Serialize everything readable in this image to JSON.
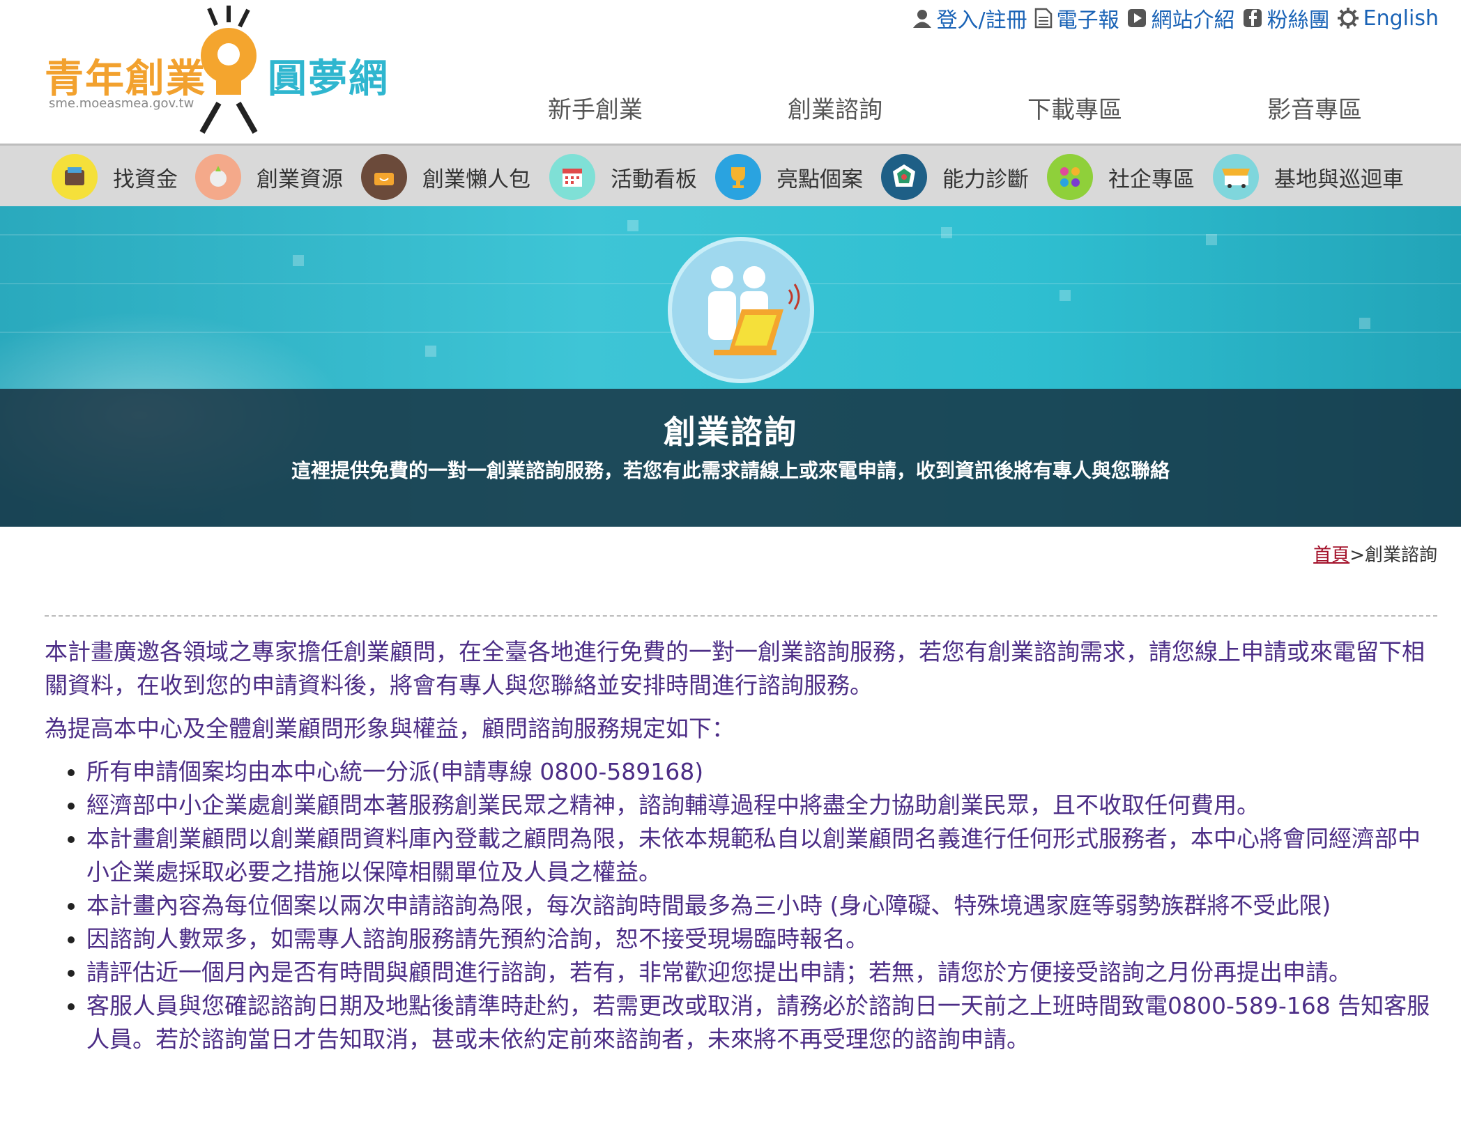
{
  "logo": {
    "text_left": "青年創業",
    "text_right": "圓夢網",
    "url": "sme.moeasmea.gov.tw"
  },
  "toplinks": [
    {
      "label": "登入/註冊",
      "icon": "user-icon"
    },
    {
      "label": "電子報",
      "icon": "document-icon"
    },
    {
      "label": "網站介紹",
      "icon": "play-icon"
    },
    {
      "label": "粉絲團",
      "icon": "facebook-icon"
    },
    {
      "label": "English",
      "icon": "gear-icon"
    }
  ],
  "mainnav": [
    "新手創業",
    "創業諮詢",
    "下載專區",
    "影音專區"
  ],
  "categories": [
    {
      "label": "找資金",
      "icon": "money-icon",
      "color": "#f5e03a"
    },
    {
      "label": "創業資源",
      "icon": "globe-icon",
      "color": "#f4a98a"
    },
    {
      "label": "創業懶人包",
      "icon": "bag-icon",
      "color": "#6b4a3a"
    },
    {
      "label": "活動看板",
      "icon": "calendar-icon",
      "color": "#7fe0d6"
    },
    {
      "label": "亮點個案",
      "icon": "trophy-icon",
      "color": "#2aa3e0"
    },
    {
      "label": "能力診斷",
      "icon": "diagnosis-icon",
      "color": "#1e5f86"
    },
    {
      "label": "社企專區",
      "icon": "community-icon",
      "color": "#8fd03a"
    },
    {
      "label": "基地與巡迴車",
      "icon": "bus-icon",
      "color": "#7fd6dc"
    }
  ],
  "banner": {
    "title": "創業諮詢",
    "subtitle": "這裡提供免費的一對一創業諮詢服務，若您有此需求請線上或來電申請，收到資訊後將有專人與您聯絡"
  },
  "breadcrumb": {
    "home": "首頁",
    "separator": ">",
    "current": "創業諮詢"
  },
  "content": {
    "intro": "本計畫廣邀各領域之專家擔任創業顧問，在全臺各地進行免費的一對一創業諮詢服務，若您有創業諮詢需求，請您線上申請或來電留下相關資料，在收到您的申請資料後，將會有專人與您聯絡並安排時間進行諮詢服務。",
    "rules_title": "為提高本中心及全體創業顧問形象與權益，顧問諮詢服務規定如下：",
    "rules": [
      "所有申請個案均由本中心統一分派(申請專線 0800-589168)",
      "經濟部中小企業處創業顧問本著服務創業民眾之精神，諮詢輔導過程中將盡全力協助創業民眾，且不收取任何費用。",
      "本計畫創業顧問以創業顧問資料庫內登載之顧問為限，未依本規範私自以創業顧問名義進行任何形式服務者，本中心將會同經濟部中小企業處採取必要之措施以保障相關單位及人員之權益。",
      "本計畫內容為每位個案以兩次申請諮詢為限，每次諮詢時間最多為三小時 (身心障礙、特殊境遇家庭等弱勢族群將不受此限)",
      "因諮詢人數眾多，如需專人諮詢服務請先預約洽詢，恕不接受現場臨時報名。",
      "請評估近一個月內是否有時間與顧問進行諮詢，若有，非常歡迎您提出申請；若無，請您於方便接受諮詢之月份再提出申請。",
      "客服人員與您確認諮詢日期及地點後請準時赴約，若需更改或取消，請務必於諮詢日一天前之上班時間致電0800-589-168 告知客服人員。若於諮詢當日才告知取消，甚或未依約定前來諮詢者，未來將不再受理您的諮詢申請。"
    ]
  }
}
